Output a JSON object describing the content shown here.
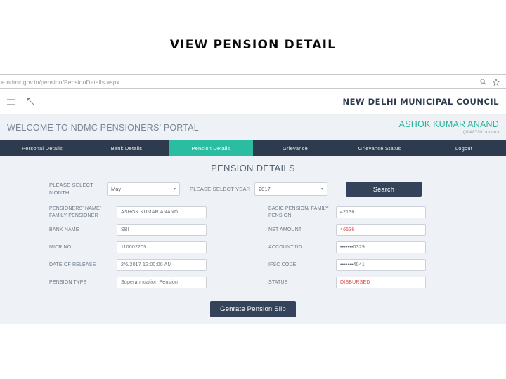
{
  "slide": {
    "title": "VIEW PENSION DETAIL"
  },
  "browser": {
    "url": "e.ndmc.gov.in/pension/PensionDetails.aspx",
    "icons": [
      "search-icon",
      "bookmark-star-icon"
    ]
  },
  "site_header": {
    "menu_icon": "hamburger-menu-icon",
    "expand_icon": "expand-arrows-icon",
    "council_name": "NEW DELHI MUNICIPAL COUNCIL"
  },
  "welcome": {
    "message": "WELCOME TO NDMC PENSIONERS' PORTAL",
    "user_name": "ASHOK KUMAR ANAND",
    "user_id": "(10487/1/1/ndmc)",
    "accent_color": "#2bb39a"
  },
  "nav": {
    "active_color": "#2bbda2",
    "bar_color": "#2e3a4d",
    "tabs": [
      {
        "label": "Personal Details",
        "active": false
      },
      {
        "label": "Bank Details",
        "active": false
      },
      {
        "label": "Pension Details",
        "active": true
      },
      {
        "label": "Grievance",
        "active": false
      },
      {
        "label": "Grievance Status",
        "active": false
      },
      {
        "label": "Logout",
        "active": false
      }
    ]
  },
  "page": {
    "heading": "PENSION DETAILS"
  },
  "filters": {
    "month_label": "PLEASE SELECT MONTH",
    "month_value": "May",
    "year_label": "PLEASE SELECT YEAR",
    "year_value": "2017",
    "search_label": "Search",
    "caret": "▾"
  },
  "details": {
    "left": [
      {
        "label": "PENSIONERS' NAME/ FAMILY PENSIONER",
        "value": "ASHOK KUMAR ANAND",
        "alert": false
      },
      {
        "label": "BANK NAME",
        "value": "SBI",
        "alert": false
      },
      {
        "label": "MICR NO.",
        "value": "110002205",
        "alert": false
      },
      {
        "label": "DATE OF RELEASE",
        "value": "2/6/2017 12:00:00 AM",
        "alert": false
      },
      {
        "label": "PENSION TYPE",
        "value": "Superannuation Pension",
        "alert": false
      }
    ],
    "right": [
      {
        "label": "BASIC PENSION/ FAMILY PENSION",
        "value": "42136",
        "alert": false
      },
      {
        "label": "NET AMOUNT",
        "value": "46636",
        "alert": true
      },
      {
        "label": "ACCOUNT NO.",
        "value": "•••••••0329",
        "alert": false
      },
      {
        "label": "IFSC CODE",
        "value": "•••••••4041",
        "alert": false
      },
      {
        "label": "STATUS",
        "value": "DISBURSED",
        "alert": true
      }
    ]
  },
  "actions": {
    "generate_label": "Genrate Pension Slip"
  }
}
